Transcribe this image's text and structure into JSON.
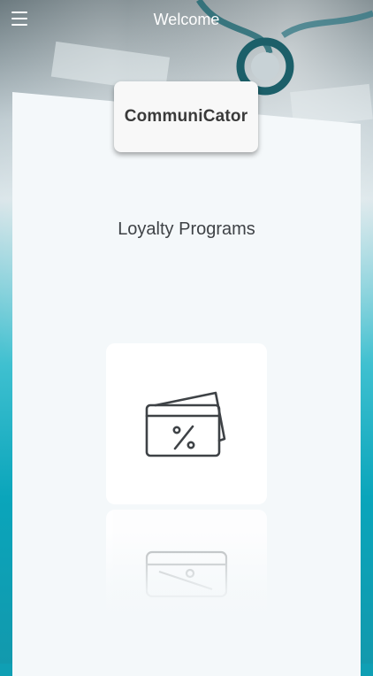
{
  "header": {
    "title": "Welcome",
    "menu_icon": "hamburger-menu-icon"
  },
  "logo": {
    "text": "CommuniCator"
  },
  "main": {
    "section_title": "Loyalty Programs",
    "tiles": [
      {
        "icon": "loyalty-card-percent-icon"
      },
      {
        "icon": "second-card-icon"
      }
    ]
  },
  "colors": {
    "accent": "#0aa5bb",
    "card": "#f4f8fa",
    "text": "#3e4246"
  }
}
